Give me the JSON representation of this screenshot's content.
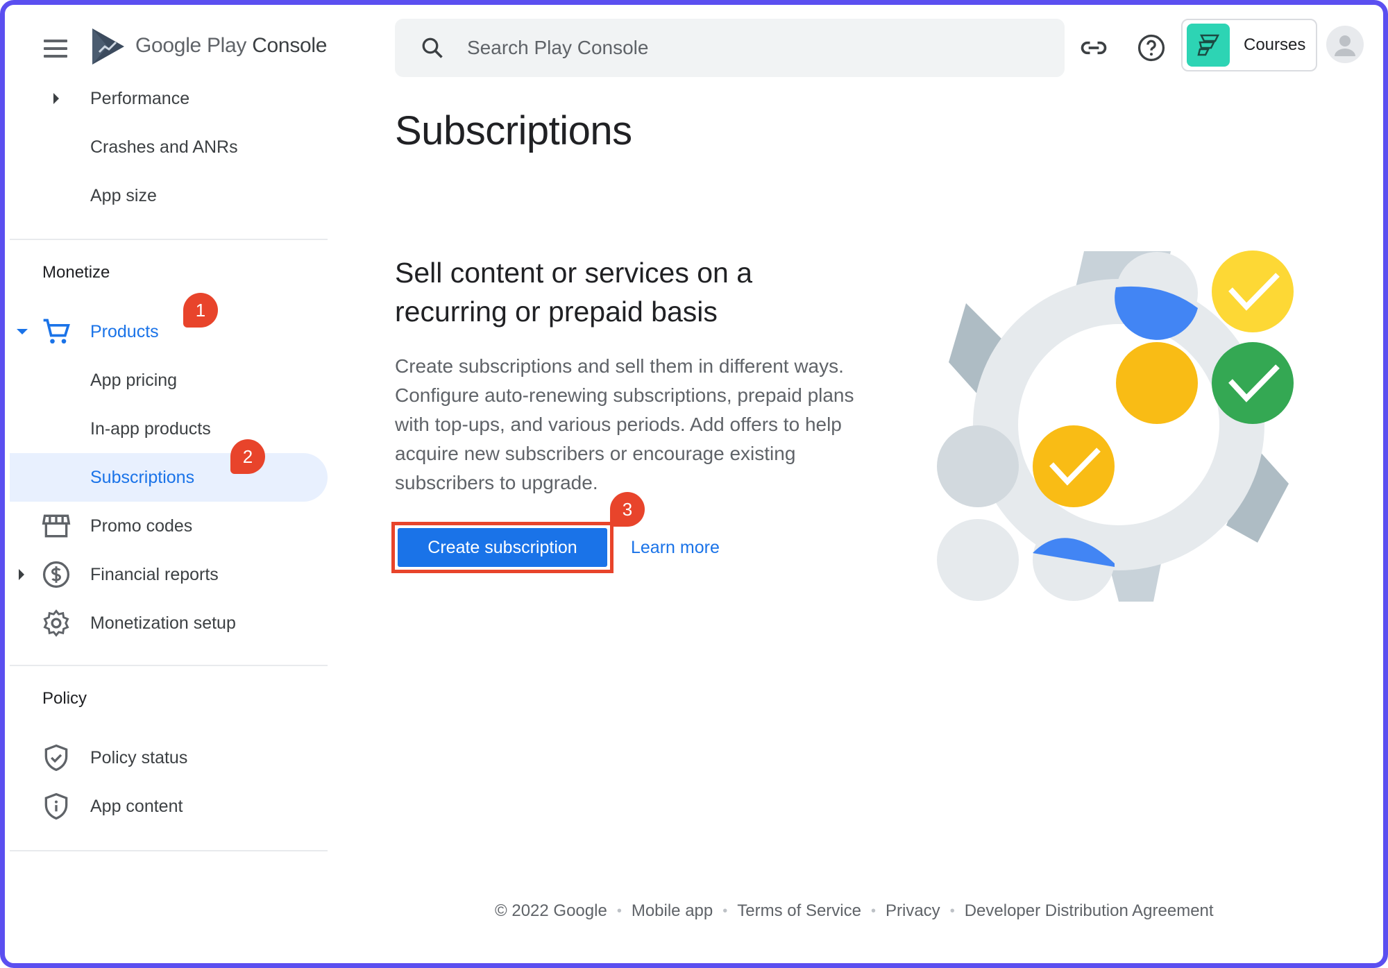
{
  "app": {
    "brand_google": "Google Play",
    "brand_console": "Console"
  },
  "search": {
    "placeholder": "Search Play Console"
  },
  "account": {
    "name": "Courses"
  },
  "sidebar": {
    "top_items": [
      {
        "label": "Performance"
      },
      {
        "label": "Crashes and ANRs"
      },
      {
        "label": "App size"
      }
    ],
    "monetize": {
      "title": "Monetize",
      "products": "Products",
      "children": [
        {
          "label": "App pricing"
        },
        {
          "label": "In-app products"
        },
        {
          "label": "Subscriptions"
        }
      ],
      "promo_codes": "Promo codes",
      "financial_reports": "Financial reports",
      "monetization_setup": "Monetization setup"
    },
    "policy": {
      "title": "Policy",
      "policy_status": "Policy status",
      "app_content": "App content"
    }
  },
  "badges": {
    "b1": "1",
    "b2": "2",
    "b3": "3"
  },
  "main": {
    "title": "Subscriptions",
    "headline": "Sell content or services on a recurring or prepaid basis",
    "description": "Create subscriptions and sell them in different ways. Configure auto-renewing subscriptions, prepaid plans with top-ups, and various periods. Add offers to help acquire new subscribers or encourage existing subscribers to upgrade.",
    "create_button": "Create subscription",
    "learn_more": "Learn more"
  },
  "footer": {
    "copyright": "© 2022 Google",
    "links": [
      "Mobile app",
      "Terms of Service",
      "Privacy",
      "Developer Distribution Agreement"
    ]
  },
  "colors": {
    "accent": "#1a73e8",
    "highlight": "#e8442b",
    "frame": "#5b4ff0"
  }
}
